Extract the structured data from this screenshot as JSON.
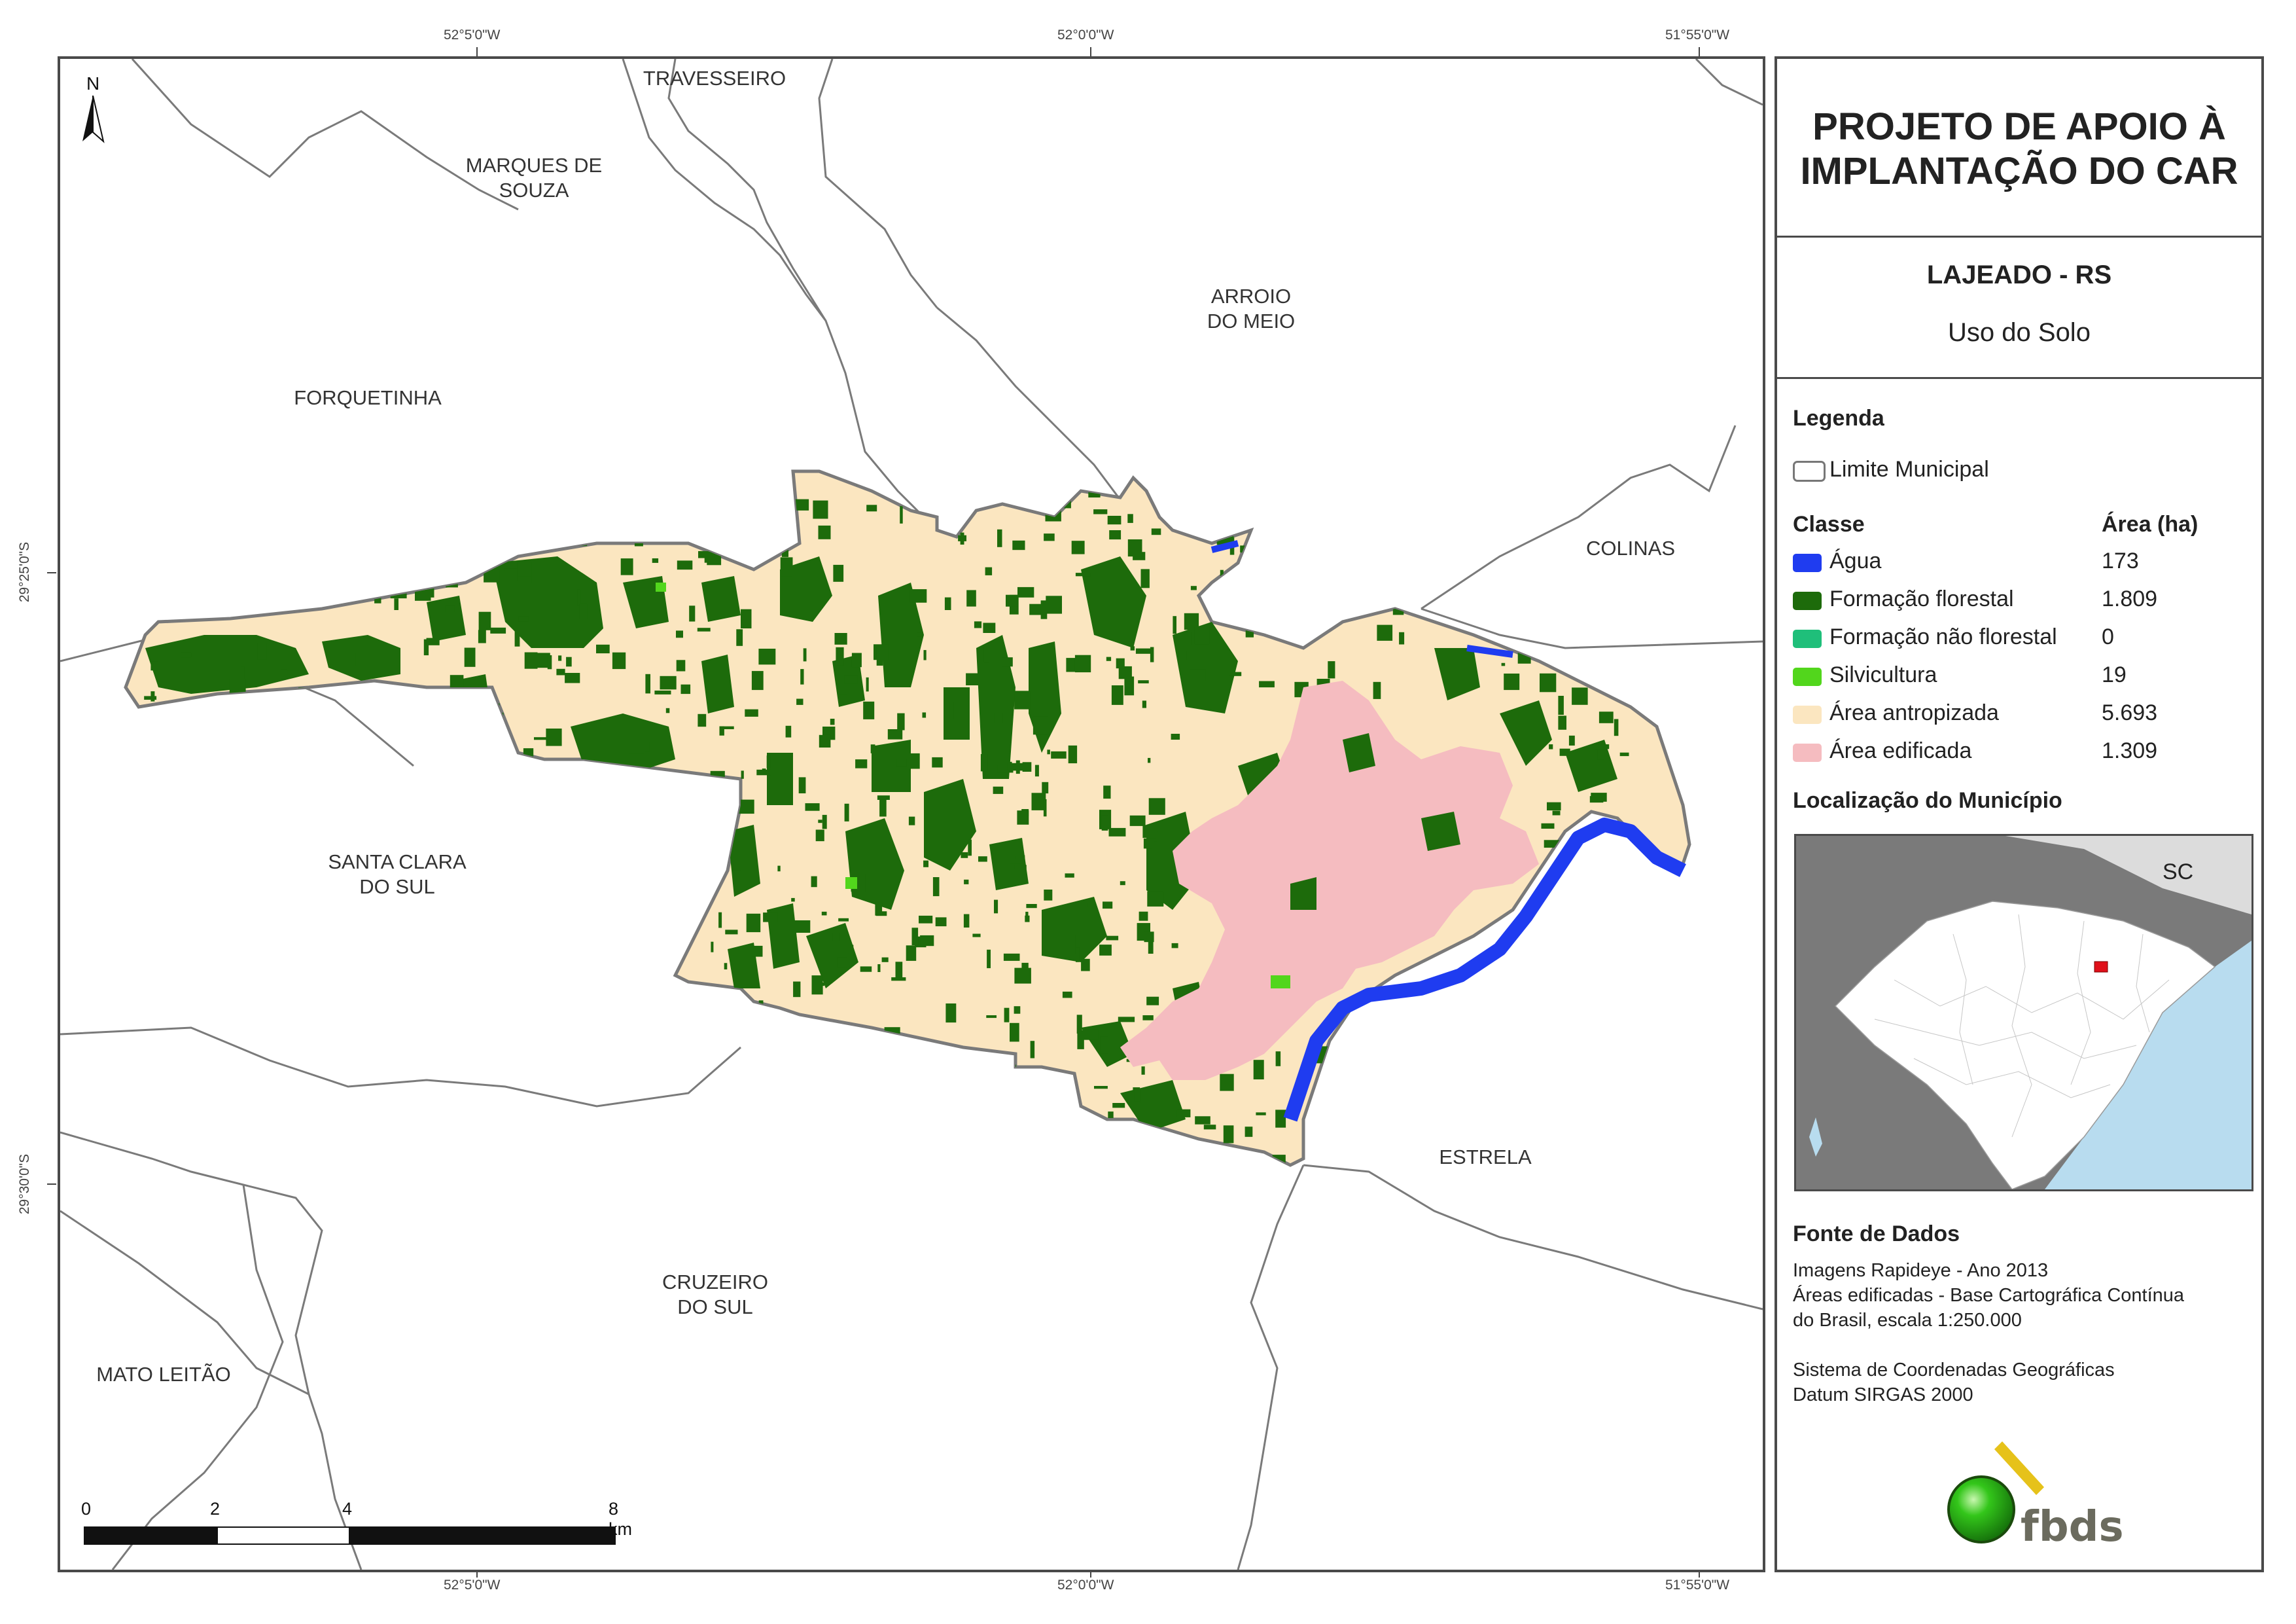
{
  "grid_labels": {
    "top": [
      "52°5'0\"W",
      "52°0'0\"W",
      "51°55'0\"W"
    ],
    "bottom": [
      "52°5'0\"W",
      "52°0'0\"W",
      "51°55'0\"W"
    ],
    "left": [
      "29°25'0\"S",
      "29°30'0\"S"
    ]
  },
  "north_arrow": "N",
  "municipalities": {
    "travesseiro": "TRAVESSEIRO",
    "marques_de_souza_1": "MARQUES DE",
    "marques_de_souza_2": "SOUZA",
    "arroio_do_meio_1": "ARROIO",
    "arroio_do_meio_2": "DO MEIO",
    "forquetinha": "FORQUETINHA",
    "colinas": "COLINAS",
    "santa_clara_1": "SANTA CLARA",
    "santa_clara_2": "DO SUL",
    "estrela": "ESTRELA",
    "cruzeiro_1": "CRUZEIRO",
    "cruzeiro_2": "DO SUL",
    "mato_leitao": "MATO LEITÃO"
  },
  "scale_bar": {
    "labels": [
      "0",
      "2",
      "4",
      "8 km"
    ]
  },
  "panel": {
    "title_line1": "PROJETO DE APOIO À",
    "title_line2": "IMPLANTAÇÃO DO CAR",
    "place": "LAJEADO - RS",
    "subtitle": "Uso do Solo",
    "legend_heading": "Legenda",
    "boundary_label": "Limite Municipal",
    "class_heading": "Classe",
    "area_heading": "Área (ha)",
    "classes": [
      {
        "label": "Água",
        "area": "173",
        "color": "#1f3cf0"
      },
      {
        "label": "Formação florestal",
        "area": "1.809",
        "color": "#1d6b0b"
      },
      {
        "label": "Formação não florestal",
        "area": "0",
        "color": "#1fbf7a"
      },
      {
        "label": "Silvicultura",
        "area": "19",
        "color": "#52d61c"
      },
      {
        "label": "Área antropizada",
        "area": "5.693",
        "color": "#fbe6c0"
      },
      {
        "label": "Área edificada",
        "area": "1.309",
        "color": "#f5bcc0"
      }
    ],
    "location_heading": "Localização do Município",
    "inset_label": "SC",
    "source_heading": "Fonte de Dados",
    "source_lines": [
      "Imagens Rapideye - Ano 2013",
      "Áreas edificadas - Base Cartográfica Contínua",
      "do Brasil, escala 1:250.000"
    ],
    "crs_lines": [
      "Sistema de Coordenadas Geográficas",
      "Datum SIRGAS 2000"
    ],
    "logo_text": "fbds"
  },
  "colors": {
    "water": "#1f3cf0",
    "forest": "#1d6b0b",
    "anthropic": "#fbe6c0",
    "urban": "#f5bcc0",
    "boundary": "#7a7a7a",
    "inset_land": "#7a7a7a",
    "inset_sea": "#b8dcef"
  }
}
